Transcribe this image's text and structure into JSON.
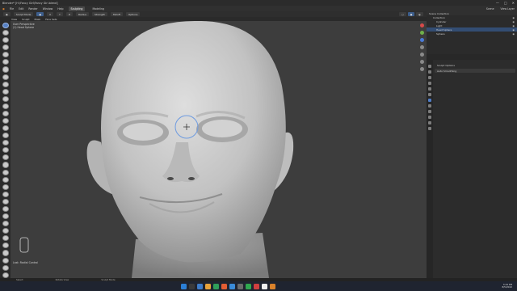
{
  "window": {
    "title": "Blender* [H:\\Fancy Girl\\Fancy Girl.blend]"
  },
  "menubar": {
    "menus": [
      "File",
      "Edit",
      "Render",
      "Window",
      "Help"
    ],
    "workspaces": [
      "Sculpting",
      "Modeling"
    ],
    "active_workspace": "Sculpting",
    "right_items": [
      "Scene",
      "View Layer"
    ]
  },
  "header3d": {
    "mode": "Sculpt Mode",
    "chips": [
      "X",
      "Y",
      "Z",
      "Radius",
      "Strength",
      "Falloff",
      "Options"
    ]
  },
  "header3d_menus": [
    "View",
    "Sculpt",
    "Mask",
    "Face Sets"
  ],
  "viewport": {
    "perspective": "User Perspective",
    "object": "(1) Head Sphere",
    "last_op": "Last: Radial Control"
  },
  "outliner": {
    "header": "Scene Collection",
    "rows": [
      {
        "label": "Collection"
      },
      {
        "label": "Cylinder"
      },
      {
        "label": "Light"
      },
      {
        "label": "Head Sphere"
      },
      {
        "label": "Sphere"
      }
    ],
    "selected_index": 3
  },
  "properties": {
    "header": "Sculpt Options",
    "field": "Auto Smoothing"
  },
  "statusbar": [
    "Select",
    "Rotate View",
    "Sculpt Mode"
  ],
  "taskbar": {
    "app_colors": [
      "#2b7fd6",
      "#3a3a3a",
      "#3d7cc9",
      "#e8a33a",
      "#2f9e5a",
      "#e25d33",
      "#3a8bd8",
      "#6a6a6a",
      "#2fa84f",
      "#cf3f3f",
      "#eeeeee",
      "#d9822b"
    ],
    "time": "3:44 PM",
    "date": "8/5/2022"
  },
  "colors": {
    "accent": "#5680c2",
    "selected_row": "#334d73"
  }
}
